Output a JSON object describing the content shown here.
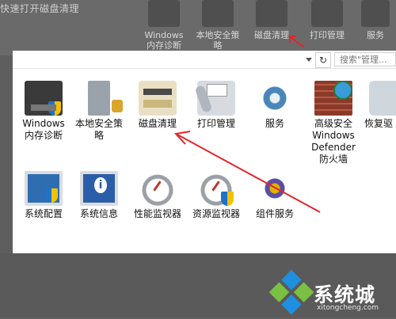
{
  "background": {
    "title": "快速打开磁盘清理",
    "icons": [
      {
        "label": "Windows\n内存诊断"
      },
      {
        "label": "本地安全策\n略"
      },
      {
        "label": "磁盘清理"
      },
      {
        "label": "打印管理"
      },
      {
        "label": "服务"
      }
    ]
  },
  "nav": {
    "refresh_glyph": "↻",
    "search_placeholder": "搜索\"管理..."
  },
  "tools": [
    {
      "label": "Windows\n内存诊断",
      "icon": "memory-diagnostics-icon"
    },
    {
      "label": "本地安全策\n略",
      "icon": "local-security-policy-icon"
    },
    {
      "label": "磁盘清理",
      "icon": "disk-cleanup-icon"
    },
    {
      "label": "打印管理",
      "icon": "print-management-icon"
    },
    {
      "label": "服务",
      "icon": "services-icon"
    },
    {
      "label": "高级安全\nWindows\nDefender\n防火墙",
      "icon": "firewall-icon"
    },
    {
      "label": "恢复驱",
      "icon": "recovery-drive-icon"
    },
    {
      "label": "系统配置",
      "icon": "system-configuration-icon"
    },
    {
      "label": "系统信息",
      "icon": "system-information-icon"
    },
    {
      "label": "性能监视器",
      "icon": "performance-monitor-icon"
    },
    {
      "label": "资源监视器",
      "icon": "resource-monitor-icon"
    },
    {
      "label": "组件服务",
      "icon": "component-services-icon"
    }
  ],
  "watermark": {
    "text_cn": "系统城",
    "text_en": "xitongcheng.com"
  },
  "colors": {
    "arrow": "#e0262b",
    "logo_blue": "#1f8fe0",
    "logo_green": "#7ac143"
  }
}
